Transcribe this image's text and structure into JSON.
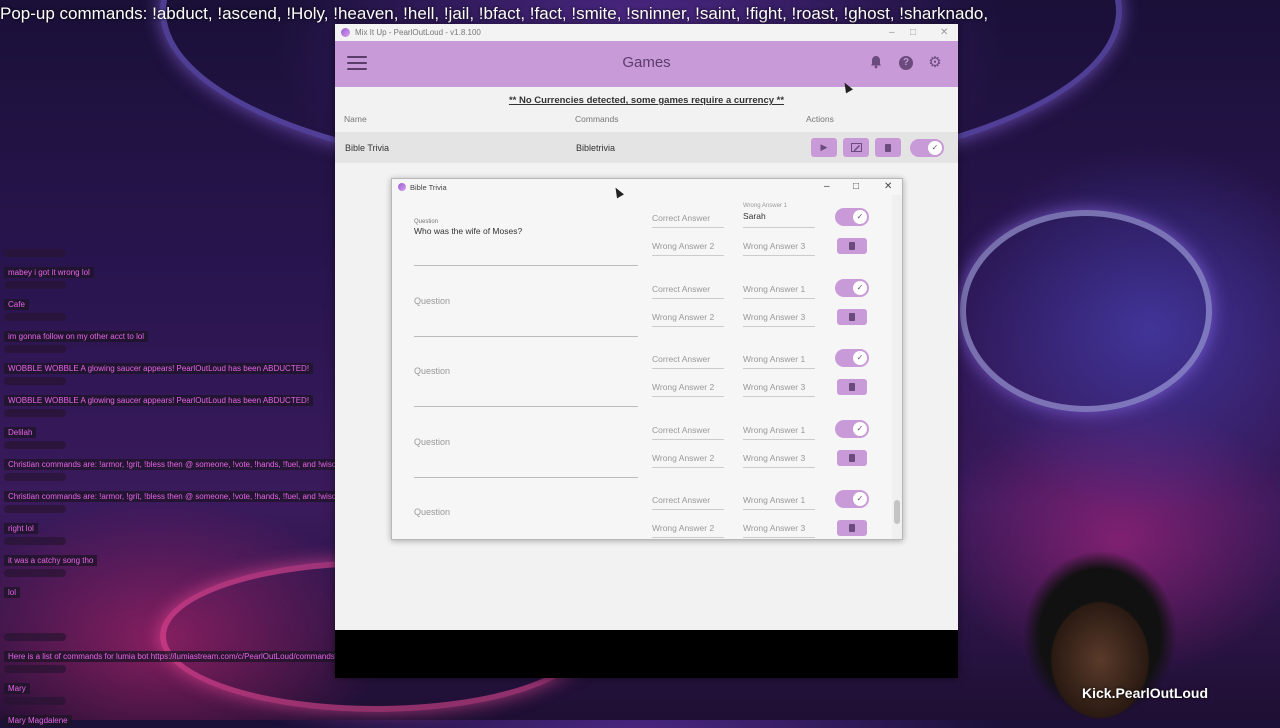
{
  "stream": {
    "popup_banner": "Pop-up commands: !abduct, !ascend, !Holy, !heaven, !hell,  !jail, !bfact, !fact, !smite, !sninner, !saint, !fight, !roast, !ghost, !sharknado,",
    "watermark": "Kick.PearlOutLoud"
  },
  "app": {
    "window_title": "Mix It Up - PearlOutLoud - v1.8.100",
    "header_title": "Games",
    "notice": "** No Currencies detected, some games require a currency **",
    "columns": {
      "name": "Name",
      "commands": "Commands",
      "actions": "Actions"
    },
    "games": [
      {
        "name": "Bible Trivia",
        "command": "Bibletrivia",
        "enabled": true
      }
    ],
    "icons": {
      "notifications": "bell-icon",
      "help": "question-icon",
      "settings": "gear-icon",
      "menu": "hamburger-icon"
    },
    "accent_color": "#c99ad8"
  },
  "trivia": {
    "window_title": "Bible Trivia",
    "question_placeholder": "Question",
    "question_label": "Question",
    "correct_placeholder": "Correct Answer",
    "wrong1_placeholder": "Wrong Answer 1",
    "wrong2_placeholder": "Wrong Answer 2",
    "wrong3_placeholder": "Wrong Answer 3",
    "wrong1_label": "Wrong Answer 1",
    "questions": [
      {
        "question": "Who was the wife of Moses?",
        "wrong1": "Sarah",
        "enabled": true
      },
      {
        "question": "",
        "enabled": true
      },
      {
        "question": "",
        "enabled": true
      },
      {
        "question": "",
        "enabled": true
      },
      {
        "question": "",
        "enabled": true
      }
    ]
  },
  "chat": {
    "messages": [
      {
        "user": "",
        "text": "mabey i got it wrong lol"
      },
      {
        "user": "",
        "text": "Cafe"
      },
      {
        "user": "",
        "text": "im gonna follow on my other acct to lol"
      },
      {
        "user": "",
        "text": "WOBBLE WOBBLE  A glowing saucer appears! PearlOutLoud has been ABDUCTED!"
      },
      {
        "user": "",
        "text": "WOBBLE WOBBLE  A glowing saucer appears! PearlOutLoud has been ABDUCTED!"
      },
      {
        "user": "",
        "text": "Delilah"
      },
      {
        "user": "",
        "text": "Christian commands are: !armor, !grit, !bless then @ someone, !vote, !hands, !fuel, and !wisdom."
      },
      {
        "user": "",
        "text": "Christian commands are: !armor, !grit, !bless then @ someone, !vote, !hands, !fuel, and !wisdom."
      },
      {
        "user": "",
        "text": "right lol"
      },
      {
        "user": "",
        "text": "it was a catchy song tho"
      },
      {
        "user": "",
        "text": "lol"
      },
      {
        "user": "",
        "text": "Here is a list of commands for lumia bot https://lumiastream.com/c/PearlOutLoud/commands"
      },
      {
        "user": "",
        "text": "Mary"
      },
      {
        "user": "",
        "text": "Mary Magdalene"
      }
    ]
  }
}
